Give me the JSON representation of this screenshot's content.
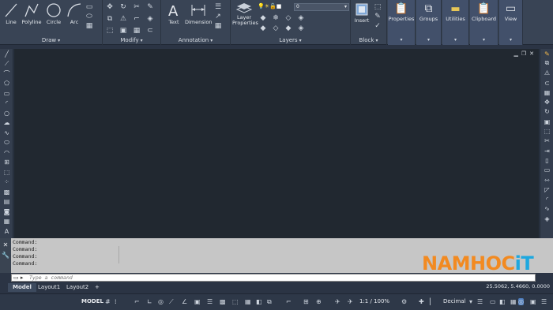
{
  "ribbon": {
    "draw": {
      "title": "Draw",
      "line": "Line",
      "polyline": "Polyline",
      "circle": "Circle",
      "arc": "Arc"
    },
    "modify": {
      "title": "Modify"
    },
    "annotation": {
      "title": "Annotation",
      "text": "Text",
      "dimension": "Dimension"
    },
    "layers": {
      "title": "Layers",
      "layer_properties_l1": "Layer",
      "layer_properties_l2": "Properties",
      "current_layer": "0"
    },
    "block": {
      "title": "Block",
      "insert": "Insert"
    },
    "properties": "Properties",
    "groups": "Groups",
    "utilities": "Utilities",
    "clipboard": "Clipboard",
    "view": "View"
  },
  "command": {
    "history": [
      "Command:",
      "Command:",
      "Command:",
      "Command:"
    ],
    "placeholder": "Type a command"
  },
  "tabs": {
    "model": "Model",
    "layout1": "Layout1",
    "layout2": "Layout2",
    "add": "+"
  },
  "coordinates": "25.5062, 5.4660, 0.0000",
  "statusbar": {
    "model": "MODEL",
    "scale": "1:1 / 100%",
    "units": "Decimal"
  },
  "watermark": {
    "part1": "NAMHOC",
    "part2": "iT"
  },
  "colors": {
    "ribbon_bg": "#394455",
    "canvas_bg": "#212830",
    "watermark_orange": "#f28a21",
    "watermark_blue": "#1ea8df"
  }
}
